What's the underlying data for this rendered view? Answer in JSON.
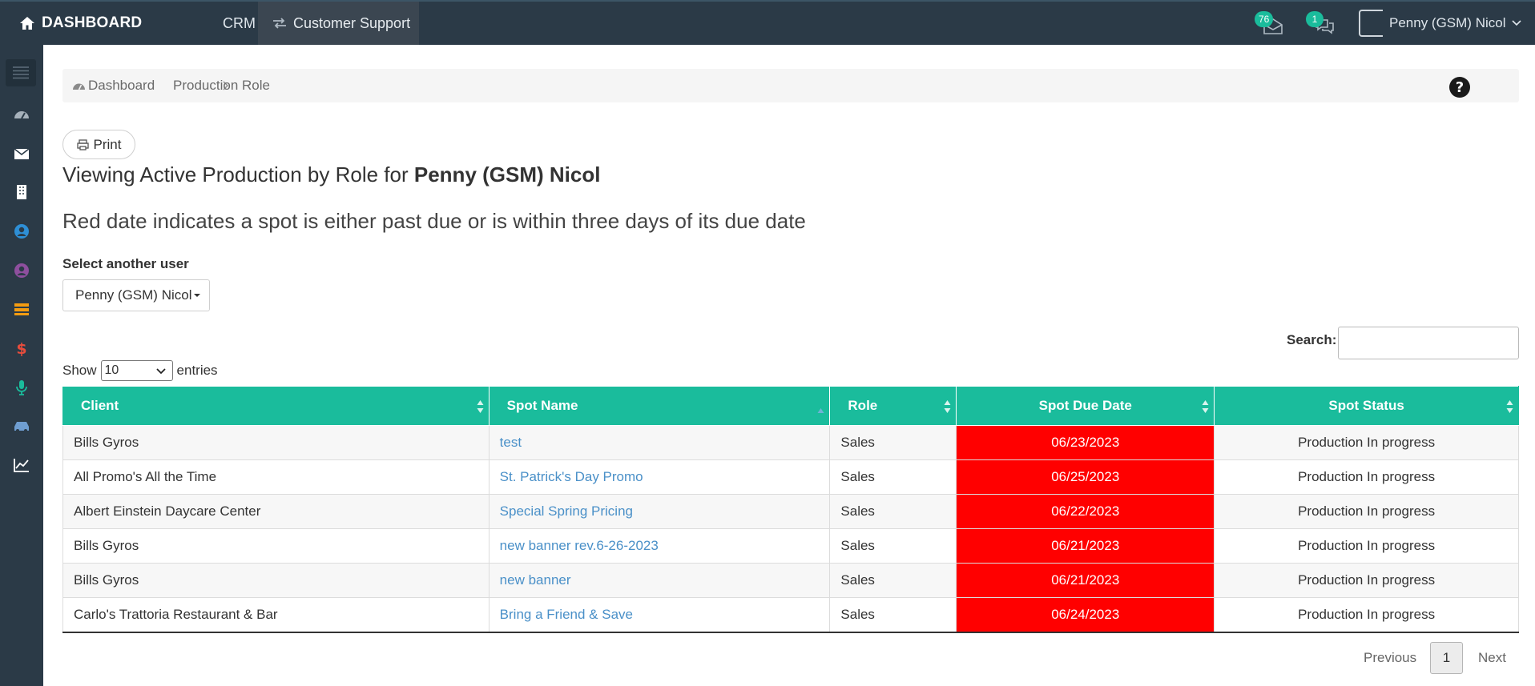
{
  "topbar": {
    "brand": "DASHBOARD",
    "nav_crm": "CRM",
    "nav_support": "Customer Support",
    "mail_count": "76",
    "chat_count": "1",
    "user_name": "Penny (GSM) Nicol"
  },
  "breadcrumb": {
    "home": "Dashboard",
    "current": "Production Role"
  },
  "print_label": "Print",
  "title_prefix": "Viewing Active Production by Role for ",
  "title_user": "Penny (GSM) Nicol",
  "subtitle": "Red date indicates a spot is either past due or is within three days of its due date",
  "select_label": "Select another user",
  "selected_user": "Penny (GSM) Nicol",
  "search_label": "Search:",
  "length": {
    "show": "Show",
    "value": "10",
    "entries": "entries"
  },
  "table": {
    "headers": {
      "client": "Client",
      "spot_name": "Spot Name",
      "role": "Role",
      "due_date": "Spot Due Date",
      "status": "Spot Status"
    },
    "rows": [
      {
        "client": "Bills Gyros",
        "spot": "test",
        "role": "Sales",
        "due": "06/23/2023",
        "status": "Production In progress"
      },
      {
        "client": "All Promo's All the Time",
        "spot": "St. Patrick's Day Promo",
        "role": "Sales",
        "due": "06/25/2023",
        "status": "Production In progress"
      },
      {
        "client": "Albert Einstein Daycare Center",
        "spot": "Special Spring Pricing",
        "role": "Sales",
        "due": "06/22/2023",
        "status": "Production In progress"
      },
      {
        "client": "Bills Gyros",
        "spot": "new banner rev.6-26-2023",
        "role": "Sales",
        "due": "06/21/2023",
        "status": "Production In progress"
      },
      {
        "client": "Bills Gyros",
        "spot": "new banner",
        "role": "Sales",
        "due": "06/21/2023",
        "status": "Production In progress"
      },
      {
        "client": "Carlo's Trattoria Restaurant & Bar",
        "spot": "Bring a Friend & Save",
        "role": "Sales",
        "due": "06/24/2023",
        "status": "Production In progress"
      }
    ]
  },
  "pagination": {
    "previous": "Previous",
    "page": "1",
    "next": "Next"
  },
  "colors": {
    "accent": "#1abc9c",
    "navbar": "#2b3a47",
    "due_red": "#ff0000",
    "link": "#4a90c8"
  },
  "sidebar_icons": [
    "menu-icon",
    "dashboard-icon",
    "envelope-icon",
    "building-icon",
    "user-circle-icon",
    "user-circle-purple-icon",
    "layers-icon",
    "dollar-icon",
    "microphone-icon",
    "car-icon",
    "chart-line-icon"
  ]
}
